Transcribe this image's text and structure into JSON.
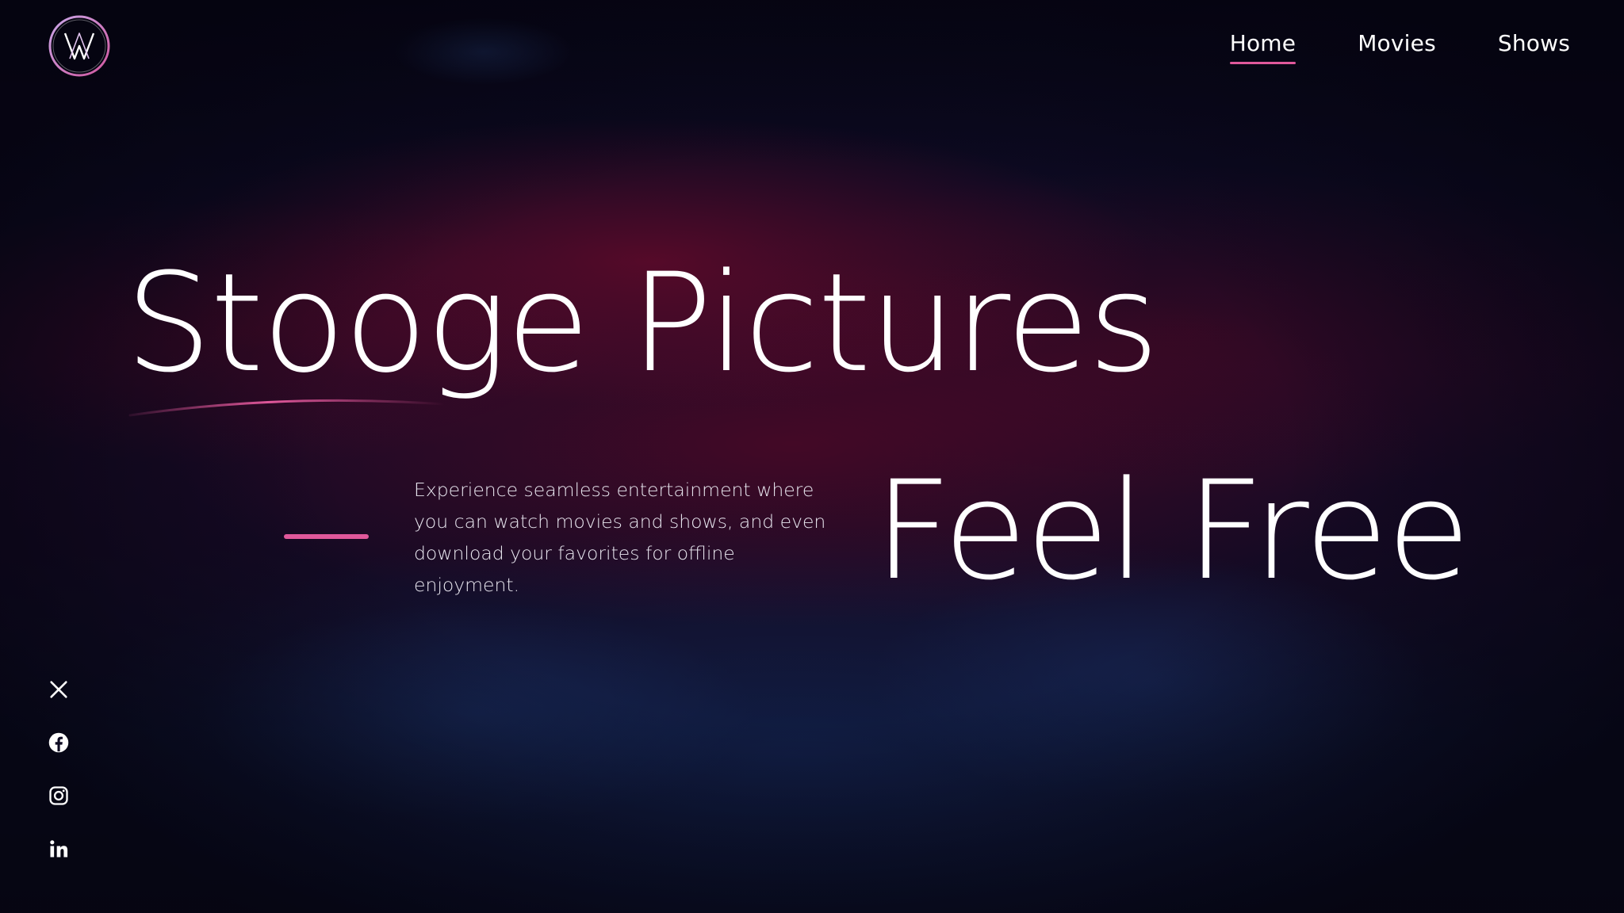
{
  "nav": {
    "items": [
      {
        "label": "Home",
        "active": true
      },
      {
        "label": "Movies",
        "active": false
      },
      {
        "label": "Shows",
        "active": false
      }
    ]
  },
  "hero": {
    "title": "Stooge Pictures",
    "description": "Experience seamless entertainment where you can watch movies and shows, and even download your favorites for offline enjoyment.",
    "slogan": "Feel Free"
  },
  "socials": [
    {
      "icon": "x-twitter-icon"
    },
    {
      "icon": "facebook-icon"
    },
    {
      "icon": "instagram-icon"
    },
    {
      "icon": "linkedin-icon"
    }
  ],
  "colors": {
    "accent": "#e0589b",
    "text": "#ffffff",
    "background": "#0b0820"
  }
}
